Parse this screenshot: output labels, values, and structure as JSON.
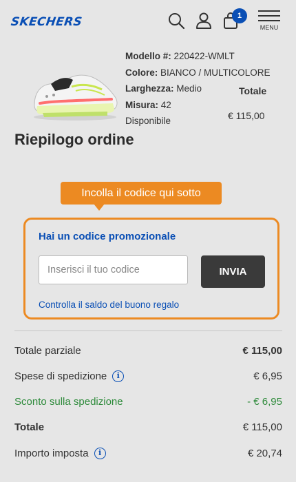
{
  "header": {
    "logo": "SKECHERS",
    "cart_count": "1",
    "menu_label": "MENU",
    "icons": [
      "search-icon",
      "user-icon",
      "bag-icon",
      "hamburger-menu-icon"
    ]
  },
  "product": {
    "model_label": "Modello #:",
    "model_value": "220422-WMLT",
    "color_label": "Colore:",
    "color_value": "BIANCO / MULTICOLORE",
    "width_label": "Larghezza:",
    "width_value": "Medio",
    "size_label": "Misura:",
    "size_value": "42",
    "availability": "Disponibile",
    "total_header": "Totale",
    "price": "€ 115,00"
  },
  "page_title": "Riepilogo ordine",
  "tooltip": "Incolla il codice qui sotto",
  "promo": {
    "title": "Hai un codice promozionale",
    "placeholder": "Inserisci il tuo codice",
    "submit": "INVIA",
    "gift_link": "Controlla il saldo del buono regalo"
  },
  "summary": {
    "subtotal_label": "Totale parziale",
    "subtotal_value": "€ 115,00",
    "shipping_label": "Spese di spedizione",
    "shipping_value": "€ 6,95",
    "discount_label": "Sconto sulla spedizione",
    "discount_value": "- € 6,95",
    "total_label": "Totale",
    "total_value": "€ 115,00",
    "tax_label": "Importo imposta",
    "tax_value": "€ 20,74"
  },
  "colors": {
    "brand_blue": "#0a4fb5",
    "accent_orange": "#ec8a22",
    "discount_green": "#2d8a3a",
    "button_dark": "#3a3a3a"
  }
}
